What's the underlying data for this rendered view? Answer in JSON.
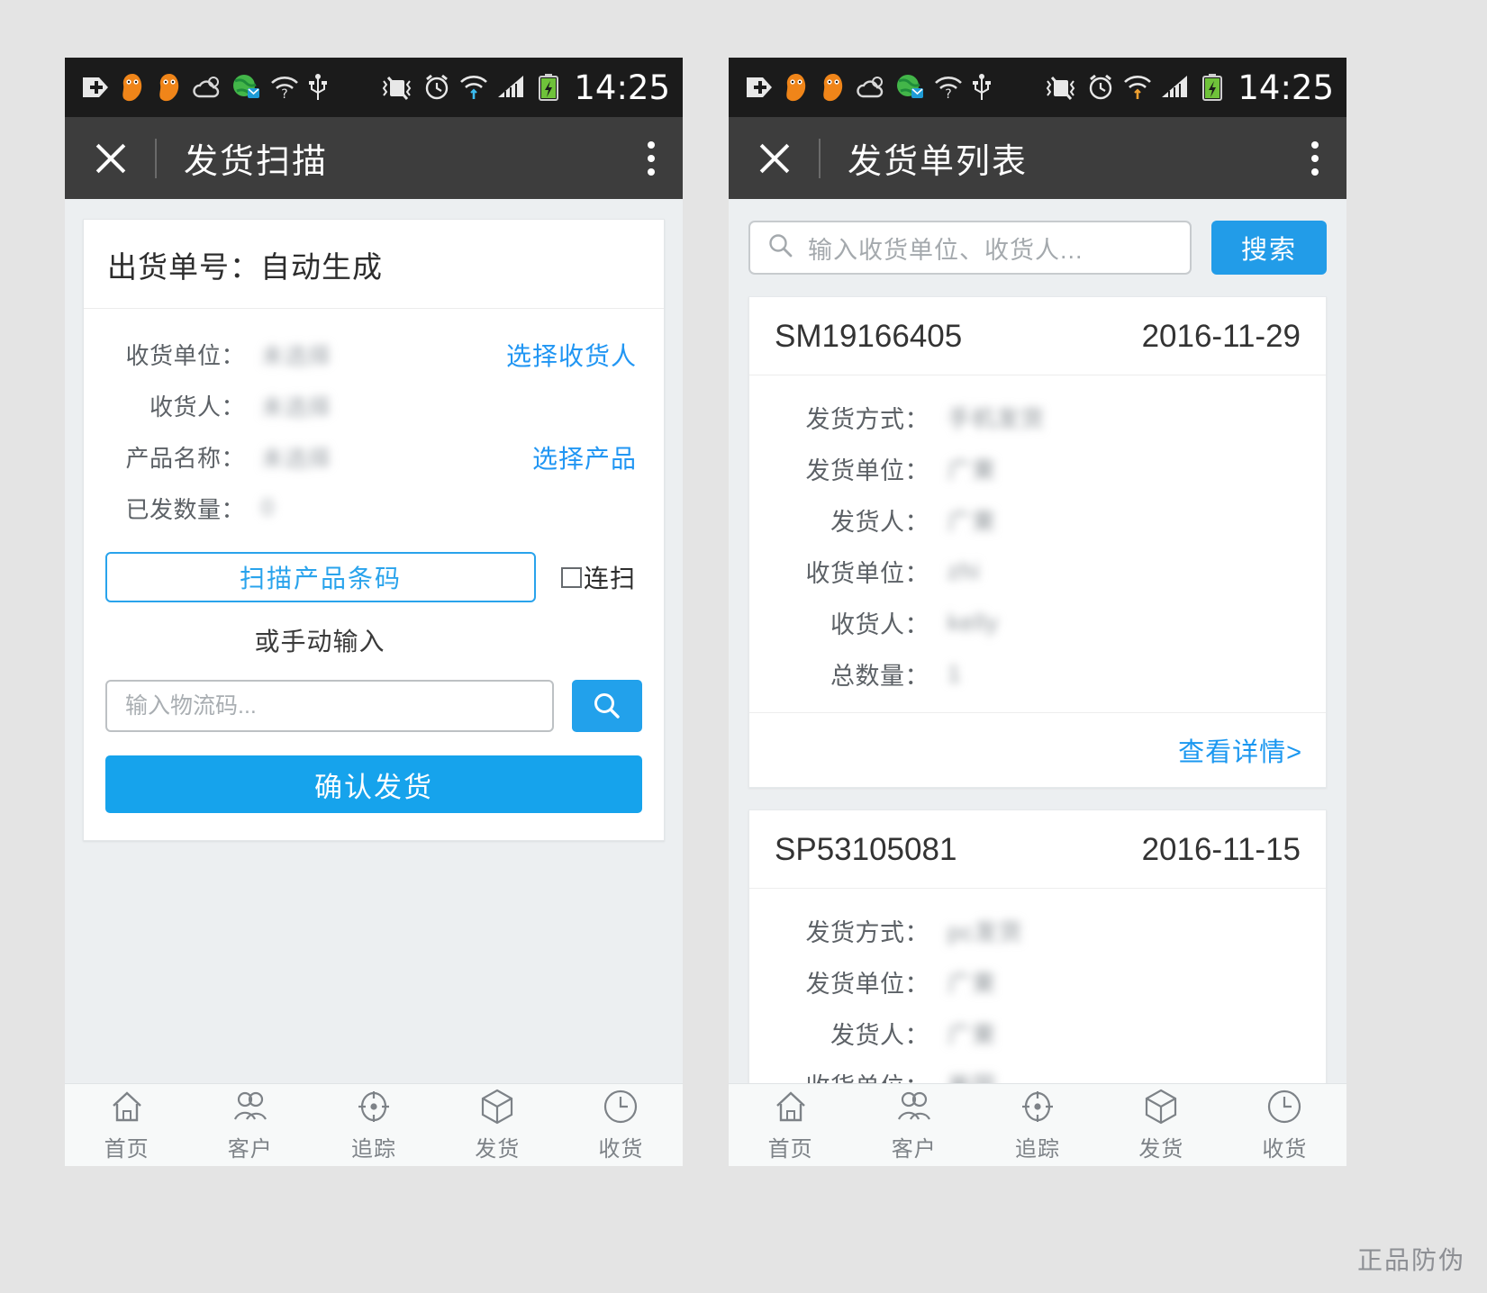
{
  "statusbar": {
    "time": "14:25",
    "icons": [
      "sdcard-plus-icon",
      "uc-browser-icon",
      "uc-browser-icon",
      "weather-cloud-icon",
      "globe-mail-icon",
      "wifi-question-icon",
      "usb-icon",
      "vibrate-off-icon",
      "alarm-icon",
      "wifi-signal-icon",
      "cellular-signal-icon",
      "battery-charging-icon"
    ]
  },
  "left": {
    "appbar": {
      "close_icon": "close-icon",
      "title": "发货扫描",
      "more_icon": "overflow-menu-icon"
    },
    "card": {
      "header": "出货单号：自动生成",
      "fields": [
        {
          "label": "收货单位：",
          "value": "未选择",
          "action": "选择收货人"
        },
        {
          "label": "收货人：",
          "value": "未选择",
          "action": ""
        },
        {
          "label": "产品名称：",
          "value": "未选择",
          "action": "选择产品"
        },
        {
          "label": "已发数量：",
          "value": "0",
          "action": ""
        }
      ],
      "scan_button": "扫描产品条码",
      "continuous_label": "连扫",
      "manual_hint": "或手动输入",
      "logistics_placeholder": "输入物流码...",
      "search_icon": "search-icon",
      "confirm_button": "确认发货"
    }
  },
  "right": {
    "appbar": {
      "close_icon": "close-icon",
      "title": "发货单列表",
      "more_icon": "overflow-menu-icon"
    },
    "search": {
      "icon": "search-icon",
      "placeholder": "输入收货单位、收货人...",
      "button": "搜索"
    },
    "orders": [
      {
        "number": "SM19166405",
        "date": "2016-11-29",
        "rows": [
          {
            "label": "发货方式：",
            "value": "手机发货"
          },
          {
            "label": "发货单位：",
            "value": "广東"
          },
          {
            "label": "发货人：",
            "value": "广東"
          },
          {
            "label": "收货单位：",
            "value": "zhi"
          },
          {
            "label": "收货人：",
            "value": "kelly"
          },
          {
            "label": "总数量：",
            "value": "1"
          }
        ],
        "detail_link": "查看详情>"
      },
      {
        "number": "SP53105081",
        "date": "2016-11-15",
        "rows": [
          {
            "label": "发货方式：",
            "value": "pc发货"
          },
          {
            "label": "发货单位：",
            "value": "广東"
          },
          {
            "label": "发货人：",
            "value": "广東"
          },
          {
            "label": "收货单位：",
            "value": "美国"
          }
        ],
        "detail_link": ""
      }
    ]
  },
  "tabbar": {
    "items": [
      {
        "icon": "home-icon",
        "label": "首页"
      },
      {
        "icon": "users-icon",
        "label": "客户"
      },
      {
        "icon": "target-icon",
        "label": "追踪"
      },
      {
        "icon": "box-icon",
        "label": "发货"
      },
      {
        "icon": "clock-icon",
        "label": "收货"
      }
    ]
  },
  "watermark": "正品防伪",
  "colors": {
    "accent": "#16a3ec",
    "link": "#1a97f0",
    "appbar": "#3d3d3d",
    "statusbar": "#1b1b1b",
    "page_bg": "#eceff1"
  }
}
